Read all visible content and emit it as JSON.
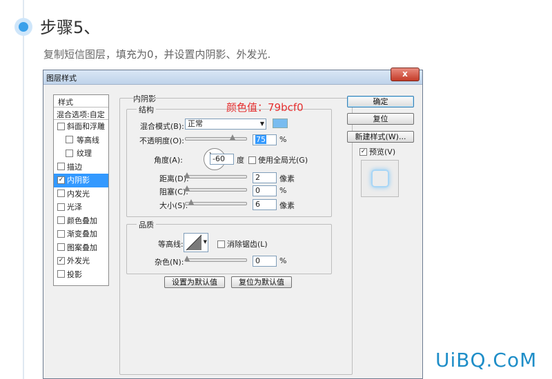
{
  "step": {
    "title": "步骤5、",
    "description": "复制短信图层，填充为0，并设置内阴影、外发光."
  },
  "watermark": "UiBQ.CoM",
  "dialog": {
    "title": "图层样式",
    "close_label": "x",
    "annotation": "颜色值：79bcf0",
    "sidebar": {
      "header": "样式",
      "blend": "混合选项:自定",
      "items": [
        {
          "label": "斜面和浮雕",
          "checked": false,
          "indent": false
        },
        {
          "label": "等高线",
          "checked": false,
          "indent": true
        },
        {
          "label": "纹理",
          "checked": false,
          "indent": true
        },
        {
          "label": "描边",
          "checked": false,
          "indent": false
        },
        {
          "label": "内阴影",
          "checked": true,
          "indent": false,
          "selected": true
        },
        {
          "label": "内发光",
          "checked": false,
          "indent": false
        },
        {
          "label": "光泽",
          "checked": false,
          "indent": false
        },
        {
          "label": "颜色叠加",
          "checked": false,
          "indent": false
        },
        {
          "label": "渐变叠加",
          "checked": false,
          "indent": false
        },
        {
          "label": "图案叠加",
          "checked": false,
          "indent": false
        },
        {
          "label": "外发光",
          "checked": true,
          "indent": false
        },
        {
          "label": "投影",
          "checked": false,
          "indent": false
        }
      ]
    },
    "panel_title": "内阴影",
    "structure": {
      "legend": "结构",
      "blend_mode_label": "混合模式(B):",
      "blend_mode_value": "正常",
      "color": "#79bcf0",
      "opacity_label": "不透明度(O):",
      "opacity_value": "75",
      "opacity_unit": "%",
      "angle_label": "角度(A):",
      "angle_value": "-60",
      "angle_unit": "度",
      "global_light_label": "使用全局光(G)",
      "global_light_checked": false,
      "distance_label": "距离(D):",
      "distance_value": "2",
      "distance_unit": "像素",
      "choke_label": "阻塞(C):",
      "choke_value": "0",
      "choke_unit": "%",
      "size_label": "大小(S):",
      "size_value": "6",
      "size_unit": "像素"
    },
    "quality": {
      "legend": "品质",
      "contour_label": "等高线:",
      "antialias_label": "消除锯齿(L)",
      "antialias_checked": false,
      "noise_label": "杂色(N):",
      "noise_value": "0",
      "noise_unit": "%"
    },
    "buttons": {
      "default": "设置为默认值",
      "reset": "复位为默认值",
      "ok": "确定",
      "cancel": "复位",
      "new_style": "新建样式(W)...",
      "preview_label": "预览(V)",
      "preview_checked": true
    }
  }
}
